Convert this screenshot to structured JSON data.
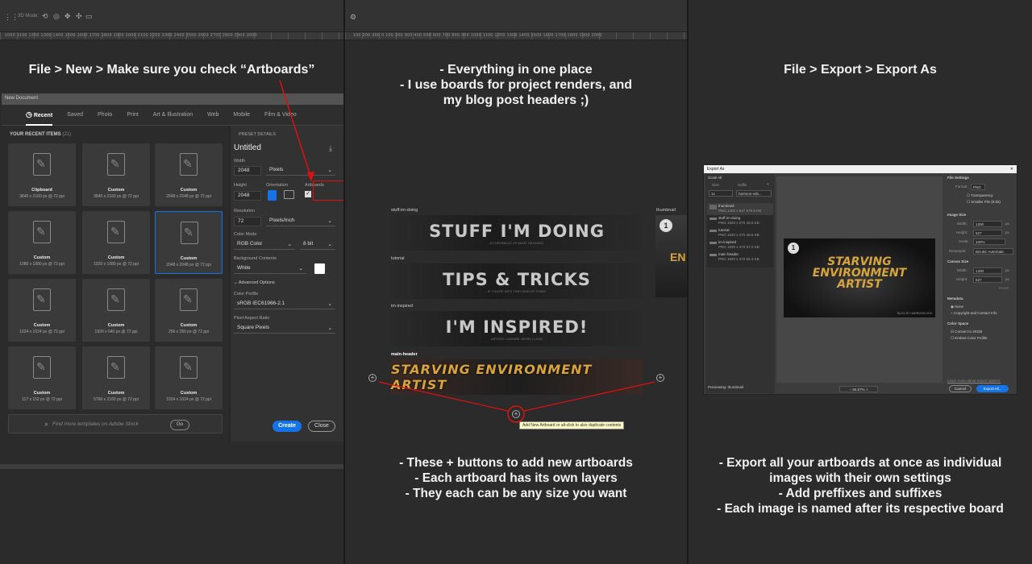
{
  "panel1": {
    "toolbar_label": "3D Mode:",
    "ruler_text": "1000 1100 1200 1300 1400 1500 1600 1700 1800 1900 2000 2100 2200 2300 2400 2500 2600 2700 2800 2900 3000",
    "caption": "File > New > Make sure you check “Artboards”",
    "dialog_title": "New Document",
    "tabs": [
      "Recent",
      "Saved",
      "Photo",
      "Print",
      "Art & Illustration",
      "Web",
      "Mobile",
      "Film & Video"
    ],
    "recent_label": "YOUR RECENT ITEMS",
    "recent_count": "(21)",
    "cards": [
      {
        "title": "Clipboard",
        "size": "3840 x 2160 px @ 72 ppi"
      },
      {
        "title": "Custom",
        "size": "3840 x 2160 px @ 72 ppi"
      },
      {
        "title": "Custom",
        "size": "2048 x 2048 px @ 72 ppi"
      },
      {
        "title": "Custom",
        "size": "1080 x 1080 px @ 72 ppi"
      },
      {
        "title": "Custom",
        "size": "1920 x 1080 px @ 72 ppi"
      },
      {
        "title": "Custom",
        "size": "2048 x 2048 px @ 72 ppi"
      },
      {
        "title": "Custom",
        "size": "1024 x 1024 px @ 72 ppi"
      },
      {
        "title": "Custom",
        "size": "1920 x 640 px @ 72 ppi"
      },
      {
        "title": "Custom",
        "size": "256 x 256 px @ 72 ppi"
      },
      {
        "title": "Custom",
        "size": "117 x 152 px @ 72 ppi"
      },
      {
        "title": "Custom",
        "size": "5760 x 2160 px @ 72 ppi"
      },
      {
        "title": "Custom",
        "size": "1024 x 1024 px @ 72 ppi"
      }
    ],
    "stock_placeholder": "Find more templates on Adobe Stock",
    "go_label": "Go",
    "preset_details": "PRESET DETAILS",
    "doc_name": "Untitled",
    "width_label": "Width",
    "width_value": "2048",
    "width_unit": "Pixels",
    "height_label": "Height",
    "height_value": "2048",
    "orientation_label": "Orientation",
    "artboards_label": "Artboards",
    "resolution_label": "Resolution",
    "resolution_value": "72",
    "resolution_unit": "Pixels/Inch",
    "color_mode_label": "Color Mode",
    "color_mode_value": "RGB Color",
    "bit_value": "8 bit",
    "bg_label": "Background Contents",
    "bg_value": "White",
    "advanced_label": "Advanced Options",
    "profile_label": "Color Profile",
    "profile_value": "sRGB IEC61966-2.1",
    "aspect_label": "Pixel Aspect Ratio",
    "aspect_value": "Square Pixels",
    "create_label": "Create",
    "close_label": "Close"
  },
  "panel2": {
    "ruler_text": "100 200 300 0 100 200 300 400 500 600 700 800 900 1000 1100 1200 1300 1400 1500 1600 1700 1800 1900 2000",
    "caption_lines": [
      "- Everything in one place",
      "- I use boards for project renders, and",
      "my blog post headers ;)"
    ],
    "artboards": [
      {
        "label": "stuff-im-doing",
        "text": "STUFF I'M DOING",
        "sub": "A CHRONICLE OF WHAT I'M DOING"
      },
      {
        "label": "tutorial",
        "text": "TIPS & TRICKS",
        "sub": "IF YOU'RE INTO THAT KIND OF THING"
      },
      {
        "label": "im-inspired",
        "text": "I'M INSPIRED!",
        "sub": "ARTISTS I ADMIRE, WORK I LOVE"
      },
      {
        "label": "main-header",
        "text": "STARVING ENVIRONMENT ARTIST",
        "sub": ""
      }
    ],
    "thumb_label": "thumbnail",
    "thumb_num": "1",
    "tooltip": "Add New Artboard or alt-click to also duplicate contents",
    "bottom_lines": [
      "- These + buttons to add new artboards",
      "- Each artboard has its own layers",
      "- They each can be any size you want"
    ]
  },
  "panel3": {
    "caption": "File > Export > Export As",
    "dialog_title": "Export As",
    "scale_all": "Scale All",
    "size_col": "Size",
    "suffix_col": "Suffix",
    "scale_value": "1x",
    "suffix_value": "harrison-vds...",
    "items": [
      {
        "name": "thumbnail",
        "fmt": "PNG",
        "dims": "1200 x 627",
        "kb": "579.9 KB"
      },
      {
        "name": "stuff-im-doing",
        "fmt": "PNG",
        "dims": "1920 x 270",
        "kb": "46.6 KB"
      },
      {
        "name": "tutorial",
        "fmt": "PNG",
        "dims": "1920 x 270",
        "kb": "48.6 KB"
      },
      {
        "name": "im-inspired",
        "fmt": "PNG",
        "dims": "1920 x 270",
        "kb": "57.0 KB"
      },
      {
        "name": "main header",
        "fmt": "PNG",
        "dims": "1920 x 270",
        "kb": "56.3 KB"
      }
    ],
    "preview_lines": [
      "STARVING",
      "ENVIRONMENT",
      "ARTIST"
    ],
    "preview_num": "1",
    "preview_credit": "BLOG BY HARRISON VDS",
    "file_settings": "File Settings",
    "format_label": "Format:",
    "format_value": "PNG",
    "transparency": "Transparency",
    "smaller_file": "Smaller File (8-bit)",
    "image_size": "Image Size",
    "width_label": "Width:",
    "width_value": "1200",
    "height_label": "Height:",
    "height_value": "627",
    "scale_label": "Scale:",
    "scale_pct": "100%",
    "resample_label": "Resample:",
    "resample_value": "Bicubic Automatic",
    "canvas_size": "Canvas Size",
    "c_width": "1200",
    "c_height": "627",
    "unit": "px",
    "reset": "Reset",
    "metadata": "Metadata",
    "none": "None",
    "copyright": "Copyright and Contact Info",
    "color_space": "Color Space",
    "convert_srgb": "Convert to sRGB",
    "embed_profile": "Embed Color Profile",
    "learn_more": "Learn more about export options.",
    "previewing": "Previewing: thumbnail",
    "zoom": "66.67%",
    "cancel": "Cancel",
    "export_all": "Export All...",
    "bottom_lines": [
      "- Export all your artboards at once as individual",
      "images with their own settings",
      "- Add preffixes and suffixes",
      "- Each image is named after its respective board"
    ]
  }
}
